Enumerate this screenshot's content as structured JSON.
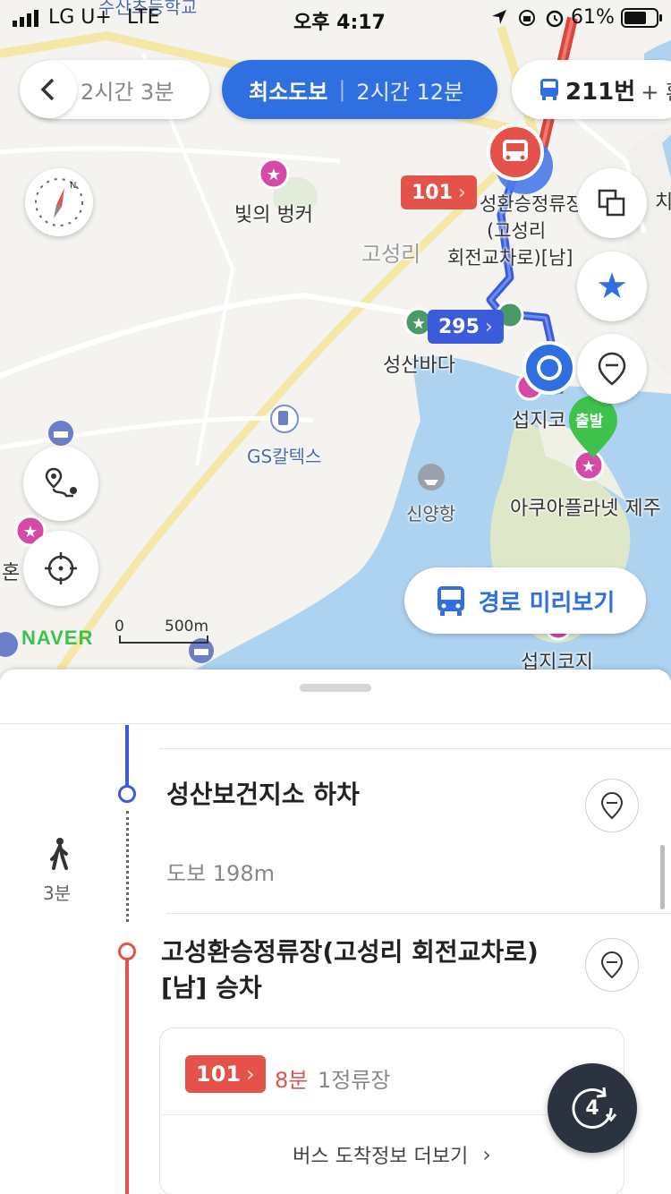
{
  "status_bar": {
    "carrier": "LG U+",
    "network": "LTE",
    "time": "오후 4:17",
    "battery": "61%"
  },
  "route_tabs": {
    "prev": {
      "time": "2시간 3분"
    },
    "active": {
      "label": "최소도보",
      "time": "2시간 12분"
    },
    "next": {
      "bus": "211번",
      "more": "+ 환"
    }
  },
  "map": {
    "labels": {
      "place1": "빛의 벙커",
      "village": "고성리",
      "place2": "성산바다",
      "gas": "GS칼텍스",
      "port": "신양항",
      "aqua": "아쿠아플라넷 제주",
      "seopji_top": "섭지코",
      "seopji_bottom": "섭지코지",
      "school": "수산초등학교",
      "partial_left": "혼",
      "stop_line1": "성환승정류장",
      "stop_line2": "(고성리",
      "stop_line3": "회전교차로)[남]",
      "partial_right": "치"
    },
    "chips": {
      "bus101": "101",
      "bus295": "295",
      "start": "출발"
    },
    "scale": {
      "zero": "0",
      "dist": "500m"
    },
    "brand": "NAVER",
    "preview_button": "경로 미리보기",
    "colors": {
      "route": "#3b5bdb",
      "bus_red": "#e5524a",
      "active_tab": "#2f6fe0",
      "naver_green": "#3ec24b"
    }
  },
  "sheet": {
    "step1": {
      "title": "성산보건지소 하차"
    },
    "walk": {
      "label": "도보 198m",
      "duration": "3분"
    },
    "step2": {
      "title_line1": "고성환승정류장(고성리 회전교차로)",
      "title_line2": "[남] 승차"
    },
    "bus_card": {
      "bus": "101",
      "eta": "8분",
      "stops": "1정류장",
      "more": "버스 도착정보 더보기"
    },
    "floating_count": "4"
  }
}
